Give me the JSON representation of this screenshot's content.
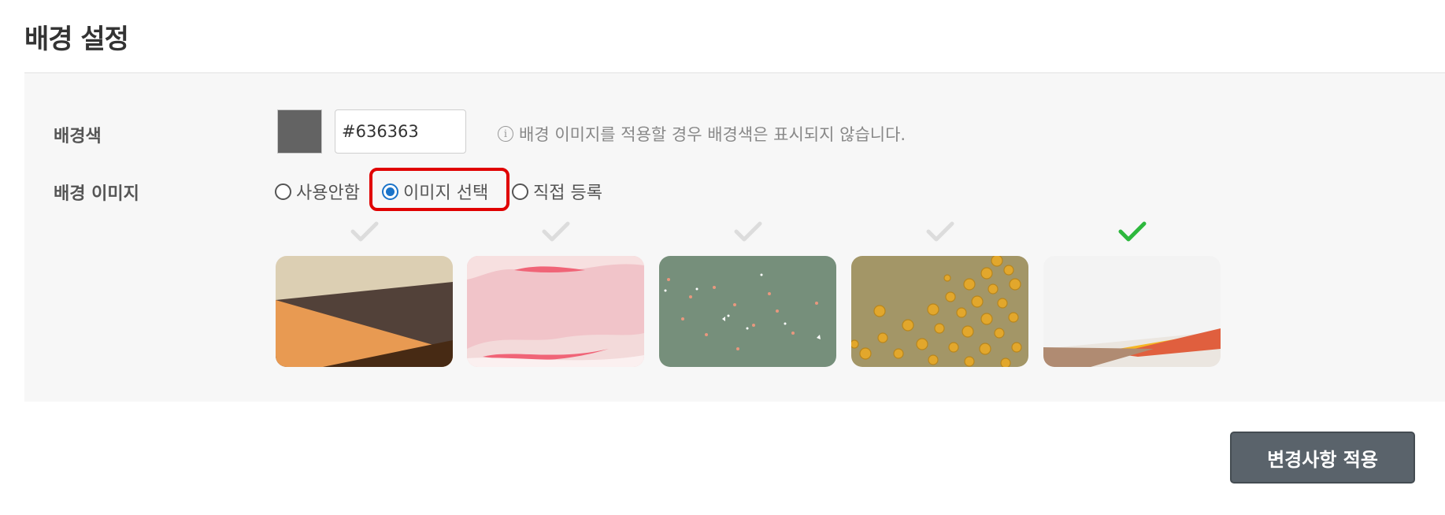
{
  "page": {
    "title": "배경 설정"
  },
  "background_color": {
    "label": "배경색",
    "value": "#636363",
    "swatch_color": "#636363",
    "hint": "배경 이미지를 적용할 경우 배경색은 표시되지 않습니다.",
    "hint_icon": "info-icon"
  },
  "background_image": {
    "label": "배경 이미지",
    "options": [
      {
        "label": "사용안함",
        "checked": false
      },
      {
        "label": "이미지 선택",
        "checked": true
      },
      {
        "label": "직접 등록",
        "checked": false
      }
    ],
    "thumbnails": [
      {
        "name": "beige-orange-geometric",
        "selected": false
      },
      {
        "name": "pink-waves",
        "selected": false
      },
      {
        "name": "green-confetti",
        "selected": false
      },
      {
        "name": "olive-gold-dots",
        "selected": false
      },
      {
        "name": "white-orange-wave",
        "selected": true
      }
    ],
    "check_colors": {
      "selected": "#2db83d",
      "unselected": "#dcdcdc"
    }
  },
  "actions": {
    "apply_label": "변경사항 적용"
  }
}
